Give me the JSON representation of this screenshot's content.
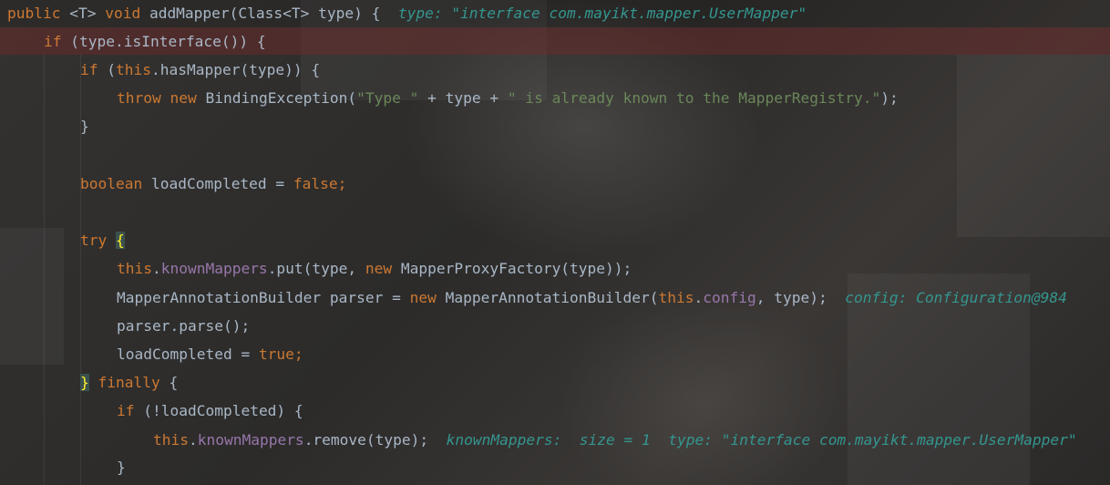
{
  "code": {
    "l1": {
      "kw_public": "public",
      "generic": " <T> ",
      "kw_void": "void",
      "rest": " addMapper(Class<T> type) {  ",
      "hint": "type: \"interface com.mayikt.mapper.UserMapper\""
    },
    "l2": {
      "kw_if": "if",
      "rest": " (type.isInterface()) {"
    },
    "l3": {
      "kw_if": "if",
      "paren": " (",
      "kw_this": "this",
      "rest": ".hasMapper(type)) {"
    },
    "l4": {
      "kw_throw": "throw",
      "kw_new": "new",
      "cls": " BindingException(",
      "str1": "\"Type \"",
      "mid": " + type + ",
      "str2": "\" is already known to the MapperRegistry.\"",
      "end": ");"
    },
    "l5": {
      "brace": "}"
    },
    "l6": {
      "kw_boolean": "boolean",
      "mid": " loadCompleted = ",
      "kw_false": "false",
      "semi": ";"
    },
    "l7": {
      "kw_try": "try",
      "brace": "{"
    },
    "l8": {
      "kw_this": "this",
      "dot": ".",
      "fld": "knownMappers",
      "mid": ".put(type, ",
      "kw_new": "new",
      "rest": " MapperProxyFactory(type));"
    },
    "l9": {
      "pre": "MapperAnnotationBuilder parser = ",
      "kw_new": "new",
      "mid": " MapperAnnotationBuilder(",
      "kw_this": "this",
      "dot": ".",
      "fld": "config",
      "end": ", type);  ",
      "hint": "config: Configuration@984"
    },
    "l10": {
      "text": "parser.parse();"
    },
    "l11": {
      "pre": "loadCompleted = ",
      "kw_true": "true",
      "semi": ";"
    },
    "l12": {
      "brace": "}",
      "kw_finally": "finally",
      "rest": " {"
    },
    "l13": {
      "kw_if": "if",
      "rest": " (!loadCompleted) {"
    },
    "l14": {
      "kw_this": "this",
      "dot": ".",
      "fld": "knownMappers",
      "rest": ".remove(type);  ",
      "hint": "knownMappers:  size = 1  type: \"interface com.mayikt.mapper.UserMapper\""
    },
    "l15": {
      "brace": "}"
    }
  },
  "colors": {
    "keyword": "#cc7832",
    "plain": "#a9b7c6",
    "string": "#6a8759",
    "field": "#9876aa",
    "inline_hint": "#34968f",
    "exec_line_highlight": "#7a2a2a"
  }
}
